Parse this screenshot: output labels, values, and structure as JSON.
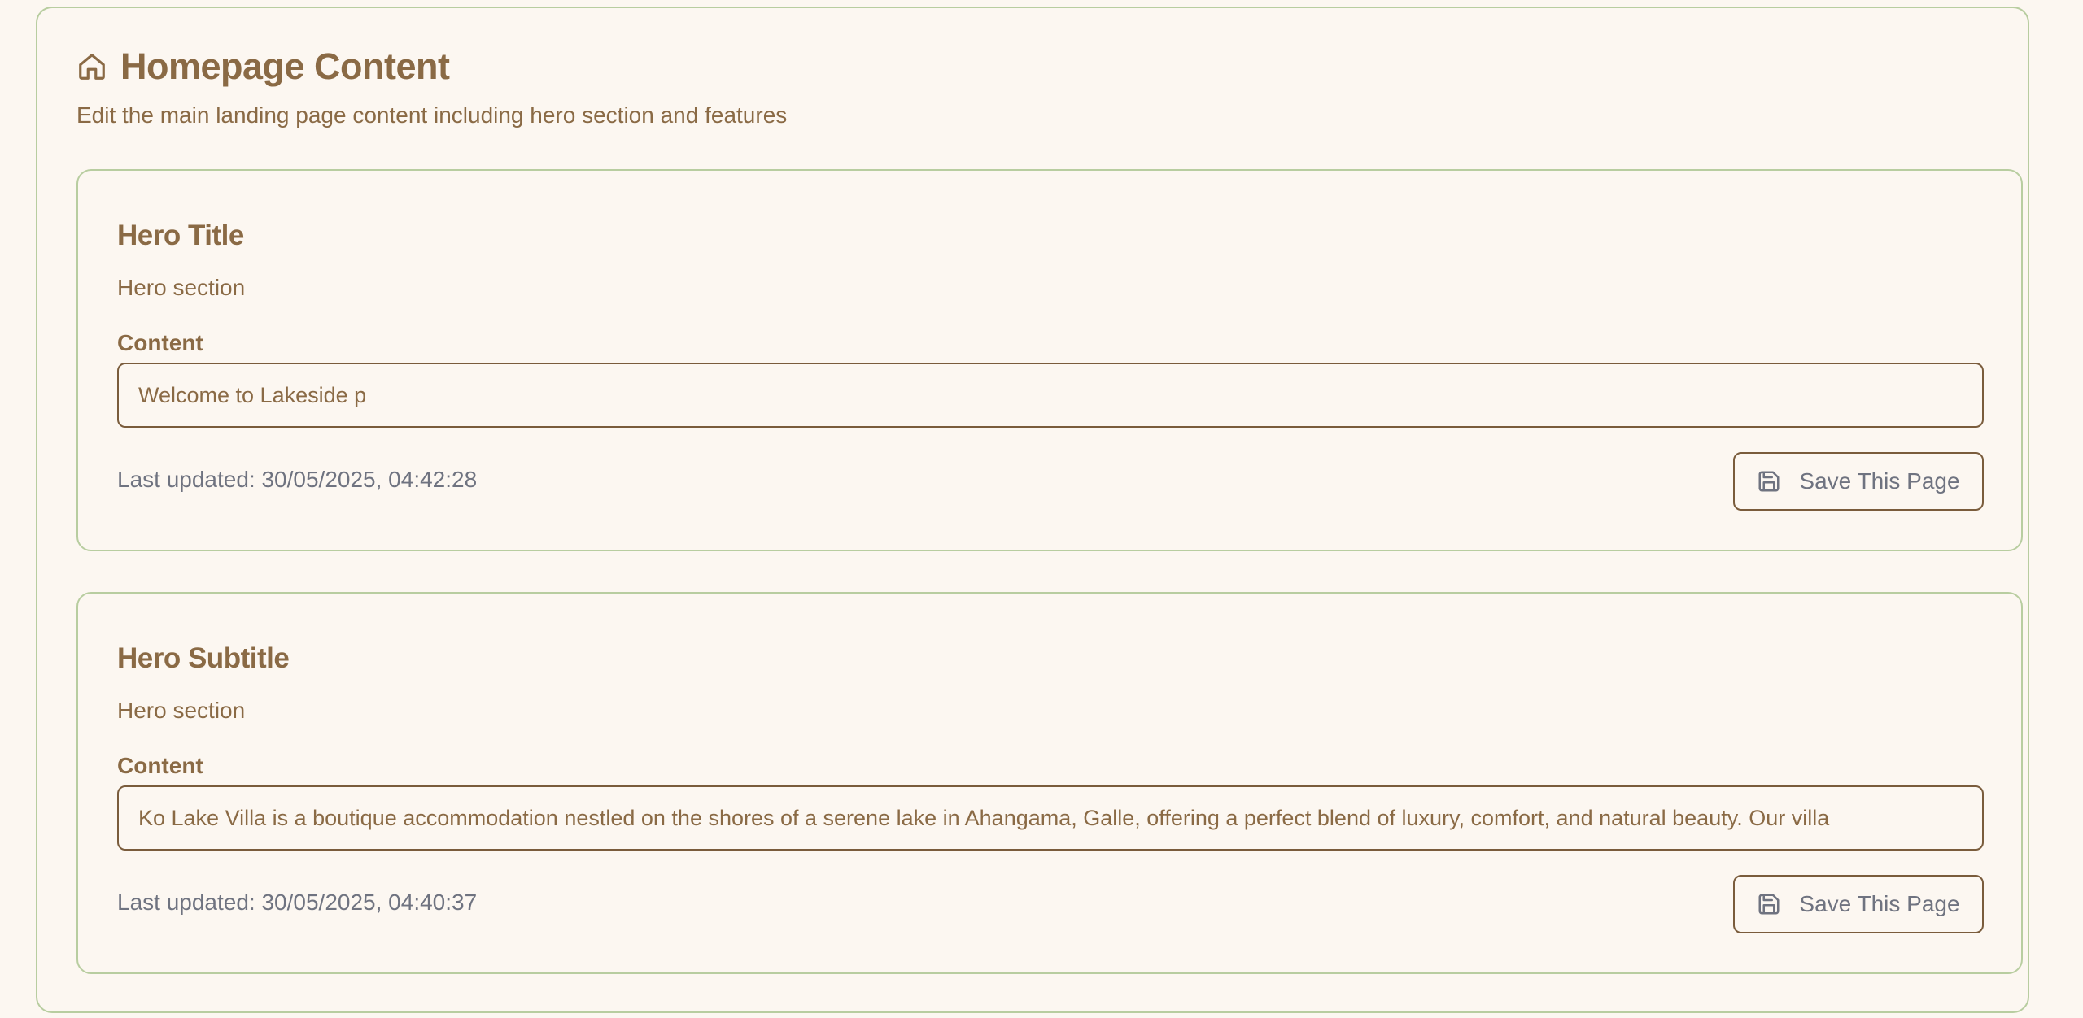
{
  "header": {
    "title": "Homepage Content",
    "subtitle": "Edit the main landing page content including hero section and features",
    "icon": "home-icon"
  },
  "cards": [
    {
      "title": "Hero Title",
      "section": "Hero section",
      "content_label": "Content",
      "content_value": "Welcome to Lakeside p",
      "last_updated": "Last updated: 30/05/2025, 04:42:28",
      "save_label": "Save This Page",
      "save_icon": "save-icon"
    },
    {
      "title": "Hero Subtitle",
      "section": "Hero section",
      "content_label": "Content",
      "content_value": "Ko Lake Villa is a boutique accommodation nestled on the shores of a serene lake in Ahangama, Galle, offering a perfect blend of luxury, comfort, and natural beauty. Our villa",
      "last_updated": "Last updated: 30/05/2025, 04:40:37",
      "save_label": "Save This Page",
      "save_icon": "save-icon"
    }
  ],
  "colors": {
    "background": "#fcf7f1",
    "accent_text": "#8a6a45",
    "border_green": "#b8cda0",
    "input_border": "#7a5c3c",
    "muted_text": "#6f7380"
  }
}
